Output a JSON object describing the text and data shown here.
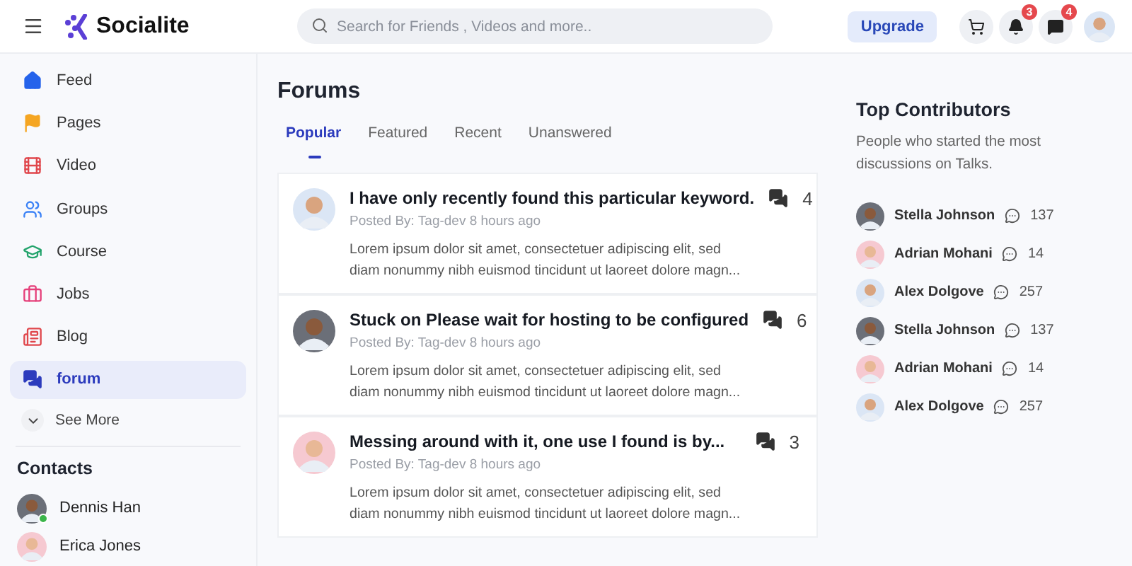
{
  "header": {
    "logo": "Socialite",
    "search": {
      "placeholder": "Search for Friends , Videos and more.."
    },
    "upgrade": "Upgrade",
    "badges": [
      "3",
      "4"
    ]
  },
  "sidebar": {
    "items": [
      {
        "label": "Feed",
        "color": "#2563eb",
        "selected": false
      },
      {
        "label": "Pages",
        "color": "#f5a623",
        "selected": false
      },
      {
        "label": "Video",
        "color": "#e0474c",
        "selected": false
      },
      {
        "label": "Groups",
        "color": "#3b82f6",
        "selected": false
      },
      {
        "label": "Course",
        "color": "#22a36b",
        "selected": false
      },
      {
        "label": "Jobs",
        "color": "#e5407a",
        "selected": false
      },
      {
        "label": "Blog",
        "color": "#e0474c",
        "selected": false
      },
      {
        "label": "forum",
        "color": "#2c3bbd",
        "selected": true
      }
    ],
    "see_more": "See More",
    "contacts_title": "Contacts",
    "contacts": [
      {
        "name": "Dennis Han",
        "online": true
      },
      {
        "name": "Erica Jones",
        "online": false
      }
    ]
  },
  "forums": {
    "title": "Forums",
    "tabs": [
      {
        "label": "Popular",
        "selected": true
      },
      {
        "label": "Featured",
        "selected": false
      },
      {
        "label": "Recent",
        "selected": false
      },
      {
        "label": "Unanswered",
        "selected": false
      }
    ],
    "posts": [
      {
        "title": "I have only recently found this particular keyword.",
        "meta": "Posted By: Tag-dev 8 hours ago",
        "body": "Lorem ipsum dolor sit amet, consectetuer adipiscing elit, sed diam nonummy nibh euismod tincidunt ut laoreet dolore magn...",
        "count": "4"
      },
      {
        "title": "Stuck on Please wait for hosting to be configured",
        "meta": "Posted By: Tag-dev 8 hours ago",
        "body": "Lorem ipsum dolor sit amet, consectetuer adipiscing elit, sed diam nonummy nibh euismod tincidunt ut laoreet dolore magn...",
        "count": "6"
      },
      {
        "title": "Messing around with it, one use I found is by...",
        "meta": "Posted By: Tag-dev 8 hours ago",
        "body": "Lorem ipsum dolor sit amet, consectetuer adipiscing elit, sed diam nonummy nibh euismod tincidunt ut laoreet dolore magn...",
        "count": "3"
      }
    ]
  },
  "contributors": {
    "title": "Top Contributors",
    "description": "People who started the most discussions on Talks.",
    "people": [
      {
        "name": "Stella Johnson",
        "count": "137"
      },
      {
        "name": "Adrian Mohani",
        "count": "14"
      },
      {
        "name": "Alex Dolgove",
        "count": "257"
      },
      {
        "name": "Stella Johnson",
        "count": "137"
      },
      {
        "name": "Adrian Mohani",
        "count": "14"
      },
      {
        "name": "Alex Dolgove",
        "count": "257"
      }
    ]
  }
}
